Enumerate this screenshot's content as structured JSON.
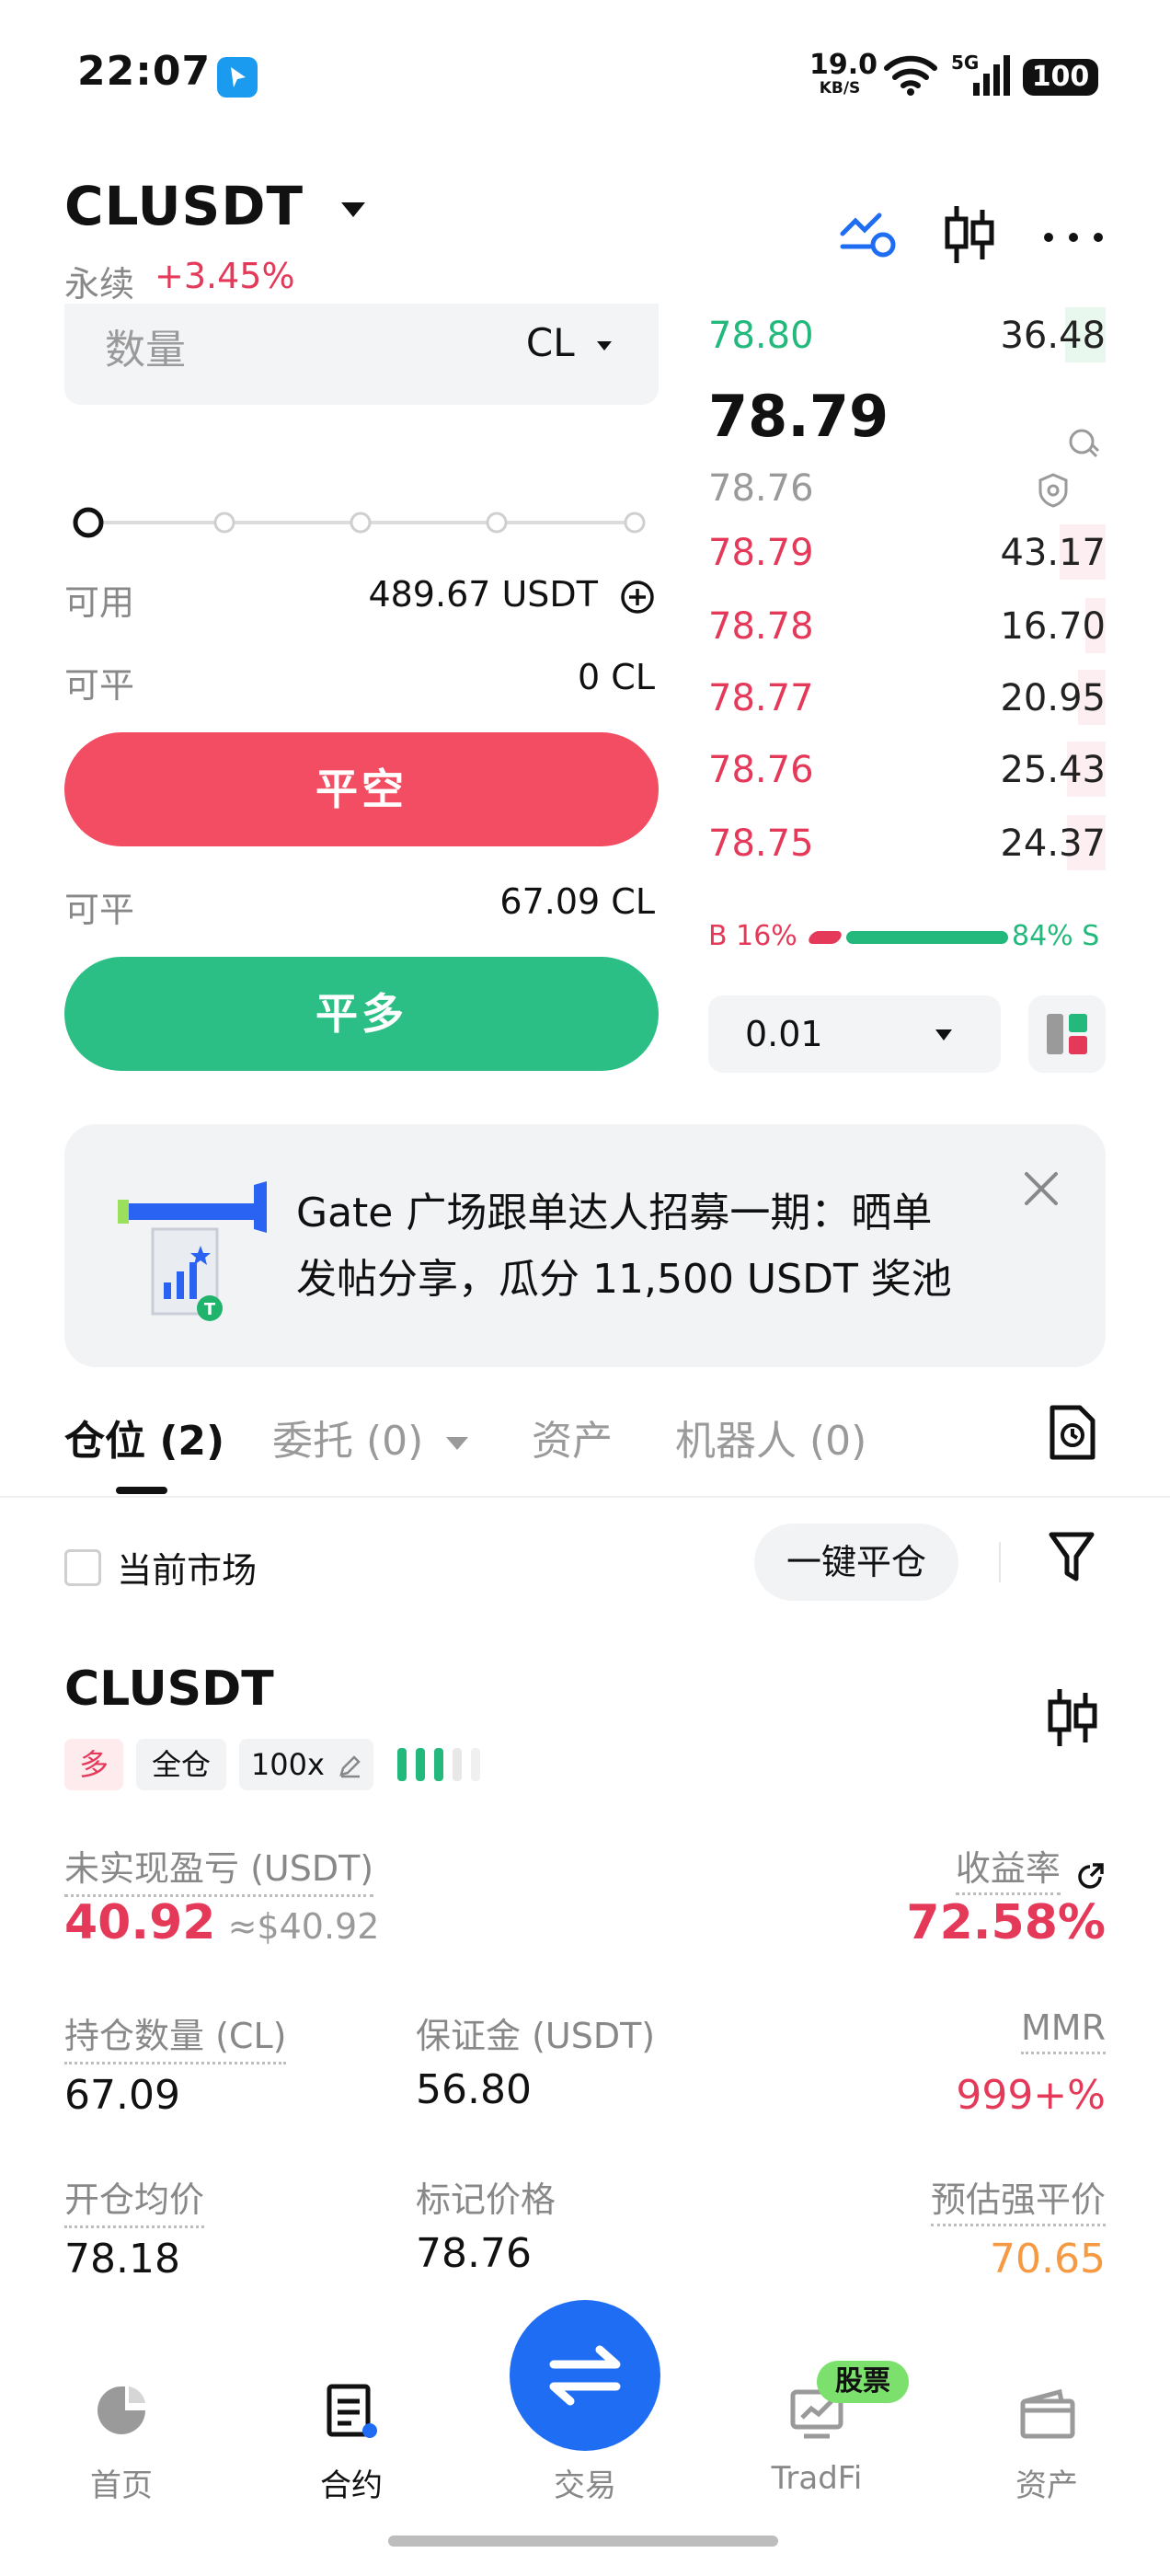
{
  "status_bar": {
    "time": "22:07",
    "net_speed_value": "19.0",
    "net_speed_unit": "KB/S",
    "network": "5G",
    "battery": "100"
  },
  "header": {
    "pair": "CLUSDT",
    "contract_type": "永续",
    "change": "+3.45%",
    "icons": [
      "chart-line-icon",
      "candlestick-icon",
      "more-icon"
    ]
  },
  "order_form": {
    "quantity_placeholder": "数量",
    "quantity_unit": "CL",
    "slider_percent": 0,
    "available_label": "可用",
    "available_value": "489.67 USDT",
    "closable_short_label": "可平",
    "closable_short_value": "0 CL",
    "close_short_button": "平空",
    "closable_long_label": "可平",
    "closable_long_value": "67.09 CL",
    "close_long_button": "平多"
  },
  "order_book": {
    "top_bid": {
      "price": "78.80",
      "qty": "36.48"
    },
    "last_price": "78.79",
    "mark_price": "78.76",
    "asks": [
      {
        "price": "78.79",
        "qty": "43.17",
        "depth": 0.12
      },
      {
        "price": "78.78",
        "qty": "16.70",
        "depth": 0.05
      },
      {
        "price": "78.77",
        "qty": "20.95",
        "depth": 0.07
      },
      {
        "price": "78.76",
        "qty": "25.43",
        "depth": 0.1
      },
      {
        "price": "78.75",
        "qty": "24.37",
        "depth": 0.1
      }
    ],
    "buy_ratio_label": "B 16%",
    "sell_ratio_label": "84% S",
    "buy_ratio": 0.16,
    "precision": "0.01"
  },
  "promo": {
    "line1": "Gate 广场跟单达人招募一期：晒单",
    "line2": "发帖分享，瓜分 11,500 USDT 奖池"
  },
  "tabs": [
    {
      "label": "仓位 (2)"
    },
    {
      "label": "委托 (0)"
    },
    {
      "label": "资产"
    },
    {
      "label": "机器人 (0)"
    }
  ],
  "filters": {
    "current_market": "当前市场",
    "close_all": "一键平仓"
  },
  "position": {
    "pair": "CLUSDT",
    "side": "多",
    "margin_mode": "全仓",
    "leverage": "100x",
    "unrealized_pnl_label": "未实现盈亏 (USDT)",
    "unrealized_pnl": "40.92",
    "unrealized_pnl_usd": "≈$40.92",
    "roe_label": "收益率",
    "roe": "72.58%",
    "size_label": "持仓数量 (CL)",
    "size": "67.09",
    "margin_label": "保证金 (USDT)",
    "margin": "56.80",
    "mmr_label": "MMR",
    "mmr": "999+%",
    "entry_label": "开仓均价",
    "entry": "78.18",
    "mark_label": "标记价格",
    "mark": "78.76",
    "liq_label": "预估强平价",
    "liq": "70.65"
  },
  "bottom_nav": {
    "items": [
      {
        "label": "首页",
        "icon": "home-icon"
      },
      {
        "label": "合约",
        "icon": "contract-icon"
      },
      {
        "label": "交易",
        "icon": "swap-icon"
      },
      {
        "label": "TradFi",
        "icon": "tradfi-icon"
      },
      {
        "label": "资产",
        "icon": "wallet-icon"
      }
    ],
    "badge": "股票"
  },
  "colors": {
    "green": "#23b97d",
    "red": "#e5395a",
    "blue": "#1f6df2",
    "orange": "#f59a42"
  }
}
